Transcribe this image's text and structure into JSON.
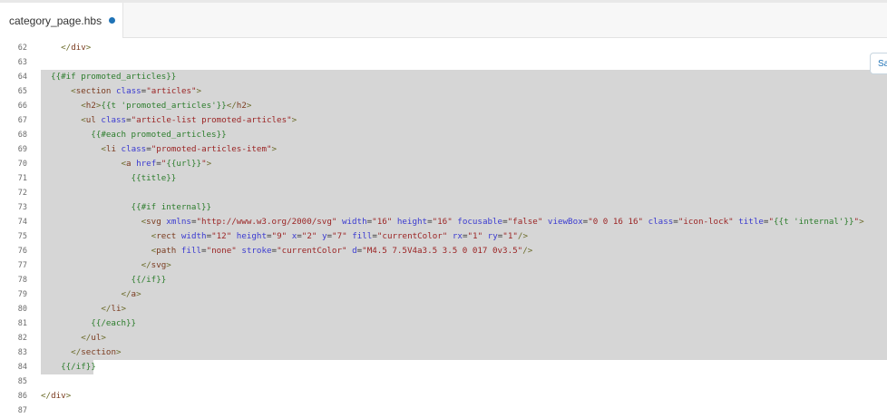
{
  "tab": {
    "filename": "category_page.hbs",
    "modified_indicator": "unsaved-dot"
  },
  "floating_button": {
    "label": "Sa"
  },
  "colors": {
    "selection": "#d6d6d6",
    "tab_dot": "#1f73b7"
  },
  "editor": {
    "lines": [
      {
        "num": "62",
        "text": "</div>",
        "indent": 4
      },
      {
        "num": "63",
        "text": "",
        "indent": 0
      },
      {
        "num": "64",
        "text": "{{#if promoted_articles}}",
        "indent": 2
      },
      {
        "num": "65",
        "text": "<section class=\"articles\">",
        "indent": 6
      },
      {
        "num": "66",
        "text": "<h2>{{t 'promoted_articles'}}</h2>",
        "indent": 8
      },
      {
        "num": "67",
        "text": "<ul class=\"article-list promoted-articles\">",
        "indent": 8
      },
      {
        "num": "68",
        "text": "{{#each promoted_articles}}",
        "indent": 10
      },
      {
        "num": "69",
        "text": "<li class=\"promoted-articles-item\">",
        "indent": 12
      },
      {
        "num": "70",
        "text": "<a href=\"{{url}}\">",
        "indent": 16
      },
      {
        "num": "71",
        "text": "{{title}}",
        "indent": 18
      },
      {
        "num": "72",
        "text": "",
        "indent": 0
      },
      {
        "num": "73",
        "text": "{{#if internal}}",
        "indent": 18
      },
      {
        "num": "74",
        "text": "<svg xmlns=\"http://www.w3.org/2000/svg\" width=\"16\" height=\"16\" focusable=\"false\" viewBox=\"0 0 16 16\" class=\"icon-lock\" title=\"{{t 'internal'}}\">",
        "indent": 20
      },
      {
        "num": "75",
        "text": "<rect width=\"12\" height=\"9\" x=\"2\" y=\"7\" fill=\"currentColor\" rx=\"1\" ry=\"1\"/>",
        "indent": 22
      },
      {
        "num": "76",
        "text": "<path fill=\"none\" stroke=\"currentColor\" d=\"M4.5 7.5V4a3.5 3.5 0 017 0v3.5\"/>",
        "indent": 22
      },
      {
        "num": "77",
        "text": "</svg>",
        "indent": 20
      },
      {
        "num": "78",
        "text": "{{/if}}",
        "indent": 18
      },
      {
        "num": "79",
        "text": "</a>",
        "indent": 16
      },
      {
        "num": "80",
        "text": "</li>",
        "indent": 12
      },
      {
        "num": "81",
        "text": "{{/each}}",
        "indent": 10
      },
      {
        "num": "82",
        "text": "</ul>",
        "indent": 8
      },
      {
        "num": "83",
        "text": "</section>",
        "indent": 6
      },
      {
        "num": "84",
        "text": "{{/if}}",
        "indent": 4
      },
      {
        "num": "85",
        "text": "",
        "indent": 0
      },
      {
        "num": "86",
        "text": "</div>",
        "indent": 0
      },
      {
        "num": "87",
        "text": "",
        "indent": 0
      }
    ],
    "selection_start_line": "64",
    "selection_end_line": "84"
  }
}
